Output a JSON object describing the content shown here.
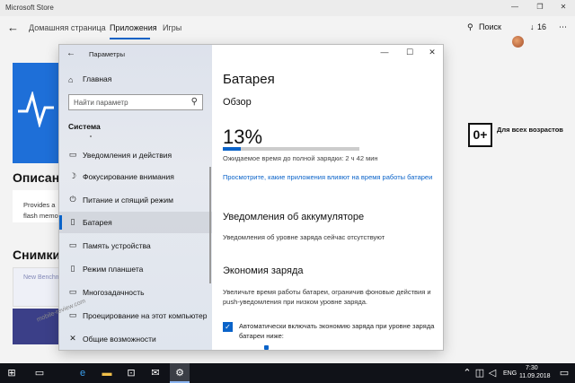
{
  "store": {
    "title": "Microsoft Store",
    "nav": {
      "back": "←",
      "home": "Домашняя страница",
      "apps": "Приложения",
      "games": "Игры",
      "search": "Поиск",
      "downloads": "16"
    },
    "description_heading": "Описание",
    "description_line1": "Provides a",
    "description_line2": "flash memo",
    "screenshots_heading": "Снимки э",
    "screenshot_caption": "New Benchmark",
    "age_rating": "0+",
    "age_text": "Для всех возрастов"
  },
  "settings": {
    "window_title": "Параметры",
    "home": "Главная",
    "search_placeholder": "Найти параметр",
    "group": "Система",
    "nav_items": [
      {
        "icon": "▭",
        "label": "Уведомления и действия"
      },
      {
        "icon": "☽",
        "label": "Фокусирование внимания"
      },
      {
        "icon": "⏻",
        "label": "Питание и спящий режим"
      },
      {
        "icon": "▯",
        "label": "Батарея"
      },
      {
        "icon": "▭",
        "label": "Память устройства"
      },
      {
        "icon": "▯",
        "label": "Режим планшета"
      },
      {
        "icon": "▭",
        "label": "Многозадачность"
      },
      {
        "icon": "▭",
        "label": "Проецирование на этот компьютер"
      },
      {
        "icon": "✕",
        "label": "Общие возможности"
      }
    ],
    "page_title": "Батарея",
    "overview": "Обзор",
    "percent": "13%",
    "battery_level": 0.13,
    "estimate": "Ожидаемое время до полной зарядки: 2 ч 42 мин",
    "link": "Просмотрите, какие приложения влияют на время работы батареи",
    "notifications_heading": "Уведомления об аккумуляторе",
    "notifications_text": "Уведомления об уровне заряда сейчас отсутствуют",
    "saver_heading": "Экономия заряда",
    "saver_text": "Увеличьте время работы батареи, ограничив фоновые действия и push-уведомления при низком уровне заряда.",
    "checkbox_label": "Автоматически включать экономию заряда при уровне заряда батареи ниже:"
  },
  "taskbar": {
    "lang": "ENG",
    "time": "7:30",
    "date": "11.09.2018"
  },
  "watermark": "mobile-review.com",
  "colors": {
    "accent": "#0a63c9",
    "taskbar": "#101218"
  }
}
